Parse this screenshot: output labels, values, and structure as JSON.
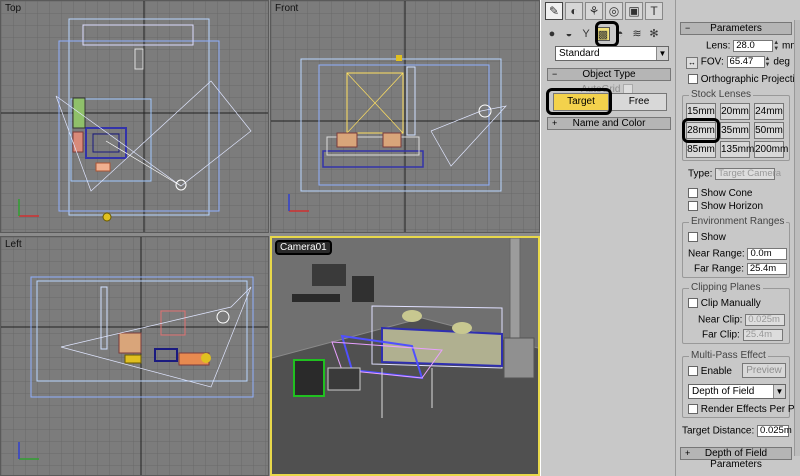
{
  "viewports": {
    "top": {
      "label": "Top"
    },
    "front": {
      "label": "Front"
    },
    "left": {
      "label": "Left"
    },
    "camera": {
      "label": "Camera01"
    }
  },
  "command_panel": {
    "tabs": [
      "create-icon",
      "modify-icon",
      "hierarchy-icon",
      "motion-icon",
      "display-icon",
      "utilities-icon"
    ],
    "category_icons": [
      "geometry-icon",
      "shapes-icon",
      "lights-icon",
      "cameras-icon",
      "helpers-icon",
      "spacewarps-icon",
      "systems-icon"
    ],
    "subcategory": "Standard",
    "object_type": {
      "title": "Object Type",
      "autogrid_label": "AutoGrid",
      "buttons": [
        "Target",
        "Free"
      ],
      "selected": "Target"
    },
    "name_and_color": {
      "title": "Name and Color"
    }
  },
  "parameters": {
    "title": "Parameters",
    "lens_label": "Lens:",
    "lens_value": "28.0",
    "lens_unit": "mm",
    "fov_label": "FOV:",
    "fov_value": "65.47",
    "fov_unit": "deg",
    "ortho_label": "Orthographic Projection",
    "stock_lenses": {
      "title": "Stock Lenses",
      "items": [
        "15mm",
        "20mm",
        "24mm",
        "28mm",
        "35mm",
        "50mm",
        "85mm",
        "135mm",
        "200mm"
      ],
      "selected": "28mm"
    },
    "type_label": "Type:",
    "type_value": "Target Camera",
    "show_cone": "Show Cone",
    "show_horizon": "Show Horizon",
    "env_ranges": {
      "title": "Environment Ranges",
      "show": "Show",
      "near_label": "Near Range:",
      "near_value": "0.0m",
      "far_label": "Far Range:",
      "far_value": "25.4m"
    },
    "clipping": {
      "title": "Clipping Planes",
      "manual": "Clip Manually",
      "near_label": "Near Clip:",
      "near_value": "0.025m",
      "far_label": "Far Clip:",
      "far_value": "25.4m"
    },
    "multipass": {
      "title": "Multi-Pass Effect",
      "enable": "Enable",
      "preview": "Preview",
      "effect": "Depth of Field",
      "per_pass": "Render Effects Per Pass"
    },
    "target_distance_label": "Target Distance:",
    "target_distance_value": "0.025m",
    "dof_params_title": "Depth of Field Parameters"
  }
}
